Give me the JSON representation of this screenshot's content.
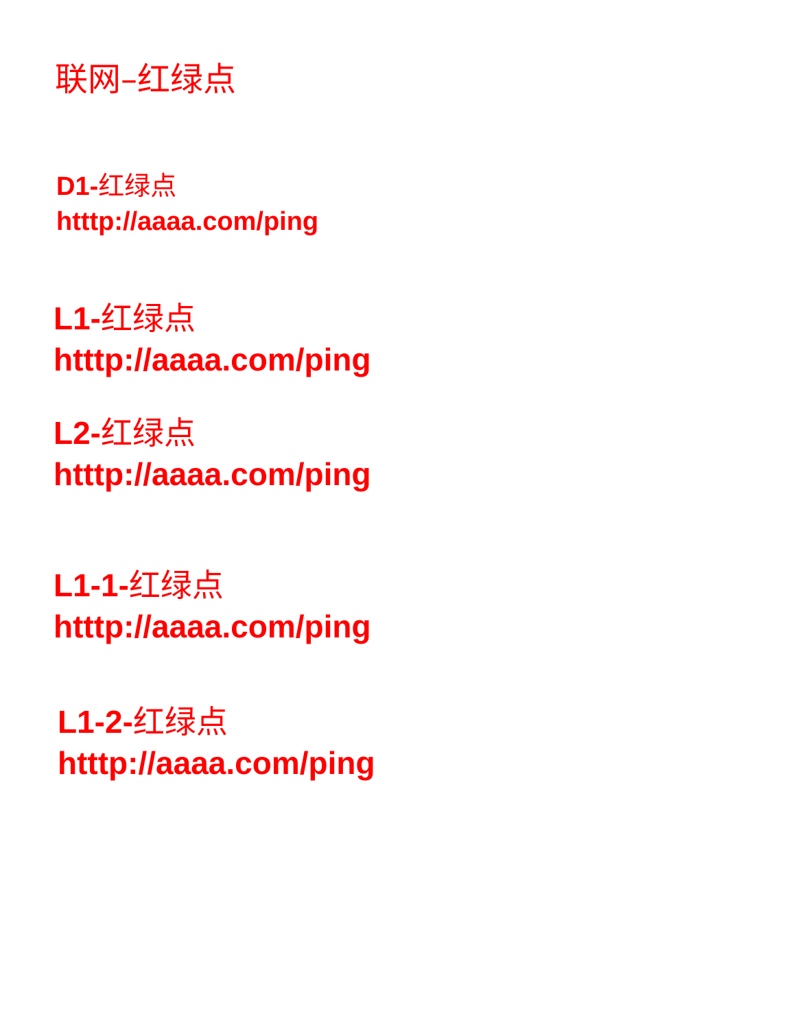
{
  "title": "联网–红绿点",
  "text_color": "#ff0000",
  "background_color": "#ffffff",
  "entries": [
    {
      "code": "D1-",
      "suffix": "红绿点",
      "url": "htttp://aaaa.com/ping"
    },
    {
      "code": "L1-",
      "suffix": "红绿点",
      "url": "htttp://aaaa.com/ping"
    },
    {
      "code": "L2-",
      "suffix": "红绿点",
      "url": "htttp://aaaa.com/ping"
    },
    {
      "code": "L1-1-",
      "suffix": "红绿点",
      "url": "htttp://aaaa.com/ping"
    },
    {
      "code": "L1-2-",
      "suffix": "红绿点",
      "url": "htttp://aaaa.com/ping"
    }
  ]
}
